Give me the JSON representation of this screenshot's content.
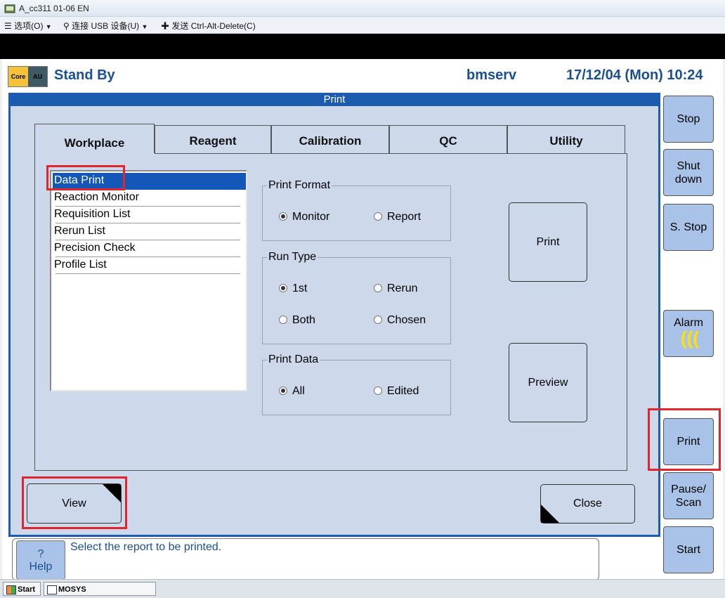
{
  "window": {
    "title": "A_cc311 01-06 EN"
  },
  "menubar": {
    "items": [
      {
        "label": "选项(O)",
        "icon": "hamburger-icon"
      },
      {
        "label": "连接 USB 设备(U)",
        "icon": "usb-icon"
      },
      {
        "label": "发送 Ctrl-Alt-Delete(C)",
        "icon": "keyboard-icon"
      }
    ]
  },
  "header": {
    "logo_left": "Core",
    "logo_right": "AU",
    "status": "Stand By",
    "user": "bmserv",
    "datetime": "17/12/04 (Mon) 10:24"
  },
  "dialog": {
    "title": "Print",
    "tabs": [
      {
        "label": "Workplace",
        "active": true
      },
      {
        "label": "Reagent",
        "active": false
      },
      {
        "label": "Calibration",
        "active": false
      },
      {
        "label": "QC",
        "active": false
      },
      {
        "label": "Utility",
        "active": false
      }
    ],
    "reports": [
      {
        "label": "Data Print",
        "selected": true
      },
      {
        "label": "Reaction Monitor",
        "selected": false
      },
      {
        "label": "Requisition List",
        "selected": false
      },
      {
        "label": "Rerun List",
        "selected": false
      },
      {
        "label": "Precision Check",
        "selected": false
      },
      {
        "label": "Profile List",
        "selected": false
      }
    ],
    "print_format": {
      "label": "Print Format",
      "options": [
        "Monitor",
        "Report"
      ],
      "selected": "Monitor"
    },
    "run_type": {
      "label": "Run Type",
      "options": [
        "1st",
        "Rerun",
        "Both",
        "Chosen"
      ],
      "selected": "1st"
    },
    "print_data": {
      "label": "Print Data",
      "options": [
        "All",
        "Edited"
      ],
      "selected": "All"
    },
    "print_button": "Print",
    "preview_button": "Preview",
    "view_button": "View",
    "close_button": "Close"
  },
  "sidebar": {
    "stop": "Stop",
    "shutdown_l1": "Shut",
    "shutdown_l2": "down",
    "sstop": "S. Stop",
    "alarm": "Alarm",
    "print": "Print",
    "pause_l1": "Pause/",
    "pause_l2": "Scan",
    "start": "Start"
  },
  "status": {
    "help_q": "?",
    "help_label": "Help",
    "message": "Select the report to be printed."
  },
  "taskbar": {
    "start": "Start",
    "app": "MOSYS"
  },
  "colors": {
    "accent": "#1c5bb0",
    "highlight": "#e0262c",
    "panel": "#cdd9ea",
    "side_button": "#a9c3e8"
  }
}
